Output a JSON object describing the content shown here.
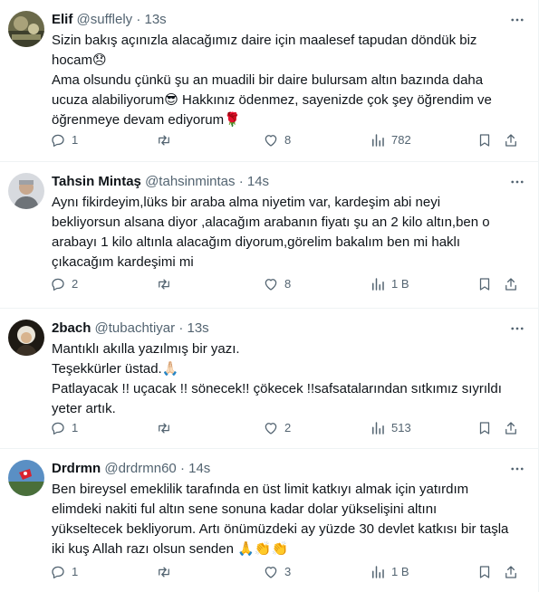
{
  "tweets": [
    {
      "name": "Elif",
      "handle": "@sufflely",
      "time": "13s",
      "lines": [
        "Sizin bakış açınızla alacağımız daire için maalesef tapudan döndük biz hocam😞",
        "Ama olsundu çünkü şu an muadili bir daire bulursam altın bazında daha ucuza alabiliyorum😎 Hakkınız ödenmez, sayenizde çok şey öğrendim ve öğrenmeye devam ediyorum🌹"
      ],
      "replies": "1",
      "retweets": "",
      "likes": "8",
      "views": "782"
    },
    {
      "name": "Tahsin Mintaş",
      "handle": "@tahsinmintas",
      "time": "14s",
      "lines": [
        "Aynı fikirdeyim,lüks bir araba alma niyetim var, kardeşim abi neyi bekliyorsun alsana diyor ,alacağım arabanın fiyatı şu an 2 kilo altın,ben o arabayı 1 kilo altınla alacağım diyorum,görelim bakalım ben mi haklı çıkacağım kardeşimi mi"
      ],
      "replies": "2",
      "retweets": "",
      "likes": "8",
      "views": "1 B"
    },
    {
      "name": "2bach",
      "handle": "@tubachtiyar",
      "time": "13s",
      "lines": [
        "Mantıklı akılla yazılmış bir yazı.",
        "Teşekkürler üstad.🙏🏻",
        "Patlayacak !! uçacak !! sönecek!! çökecek !!safsatalarından sıtkımız sıyrıldı yeter artık."
      ],
      "replies": "1",
      "retweets": "",
      "likes": "2",
      "views": "513"
    },
    {
      "name": "Drdrmn",
      "handle": "@drdrmn60",
      "time": "14s",
      "lines": [
        "Ben bireysel emeklilik tarafında en üst limit katkıyı almak için yatırdım elimdeki nakiti ful altın sene sonuna kadar dolar yükselişini altını yükseltecek bekliyorum. Artı önümüzdeki ay yüzde 30 devlet katkısı bir taşla iki kuş Allah razı olsun senden 🙏👏👏"
      ],
      "replies": "1",
      "retweets": "",
      "likes": "3",
      "views": "1 B"
    }
  ],
  "separator": "·",
  "icons": {
    "reply": "reply-icon",
    "retweet": "retweet-icon",
    "like": "heart-icon",
    "views": "views-chart-icon",
    "bookmark": "bookmark-icon",
    "share": "share-icon",
    "more": "more-dots-icon"
  },
  "colors": {
    "text": "#0f1419",
    "secondary": "#536471",
    "border": "#eff3f4"
  }
}
